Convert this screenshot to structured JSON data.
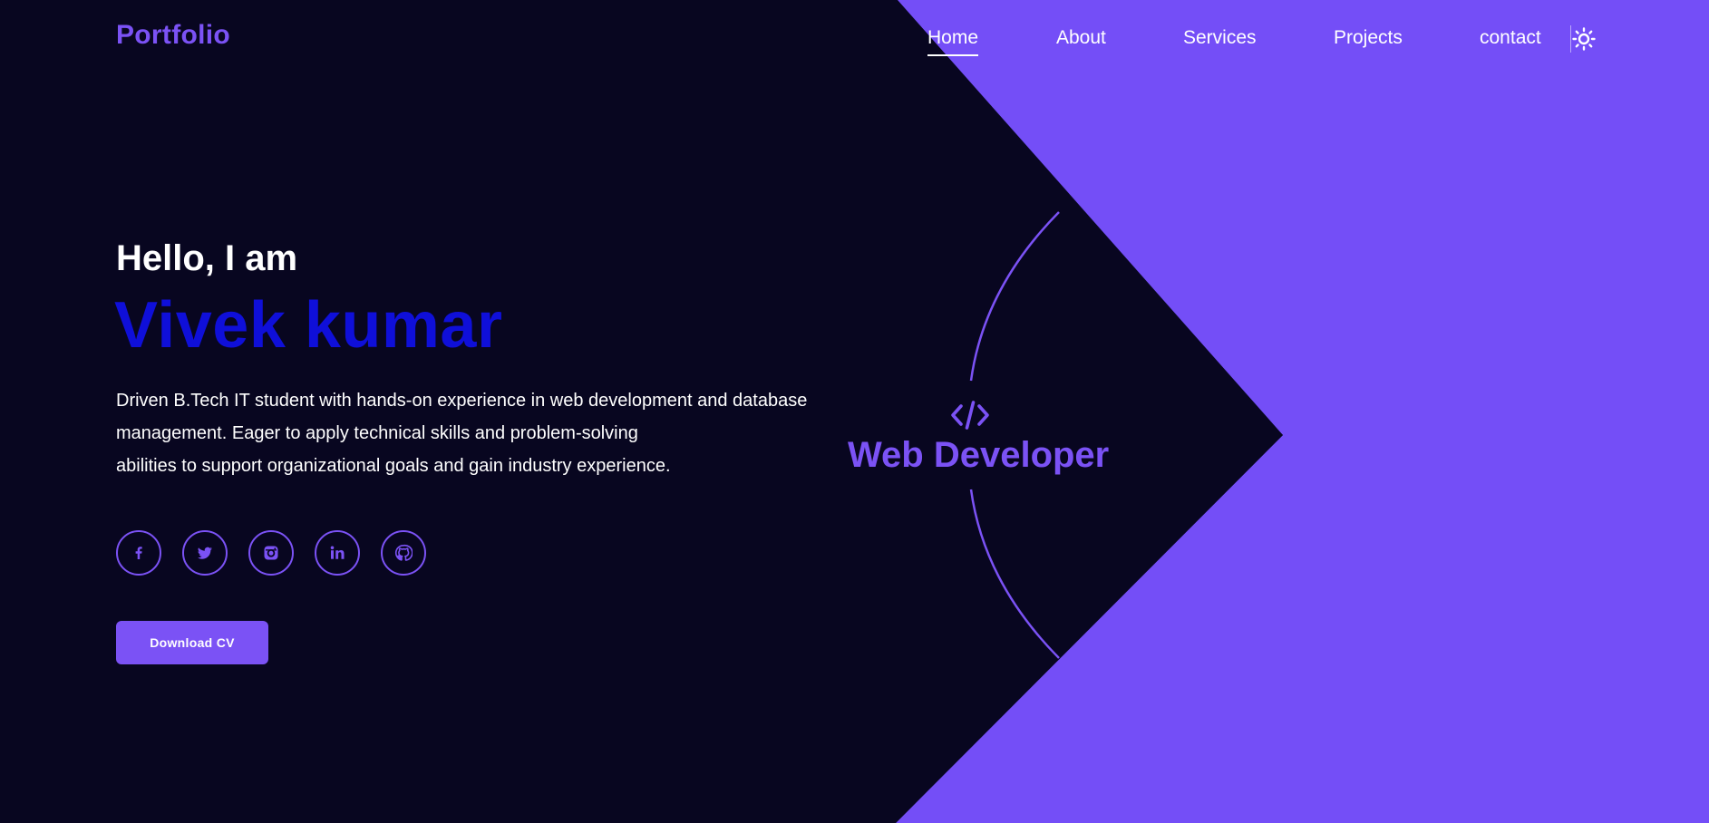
{
  "header": {
    "logo": "Portfolio",
    "nav": [
      {
        "label": "Home",
        "active": true
      },
      {
        "label": "About",
        "active": false
      },
      {
        "label": "Services",
        "active": false
      },
      {
        "label": "Projects",
        "active": false
      },
      {
        "label": "contact",
        "active": false
      }
    ],
    "theme_toggle_icon": "sun-icon"
  },
  "hero": {
    "greeting": "Hello, I am",
    "name": "Vivek kumar",
    "bio_lines": [
      "Driven B.Tech IT student with hands-on experience in web development and database",
      "management. Eager to apply technical skills and problem-solving",
      "abilities to support organizational goals and gain industry experience."
    ],
    "socials": [
      {
        "icon": "facebook-icon"
      },
      {
        "icon": "twitter-icon"
      },
      {
        "icon": "instagram-icon"
      },
      {
        "icon": "linkedin-icon"
      },
      {
        "icon": "github-icon"
      }
    ],
    "download_label": "Download CV"
  },
  "role": {
    "icon": "code-icon",
    "title": "Web Developer"
  },
  "colors": {
    "background": "#080620",
    "accent": "#7b52f5",
    "name": "#0f0fd9",
    "text": "#ffffff"
  }
}
